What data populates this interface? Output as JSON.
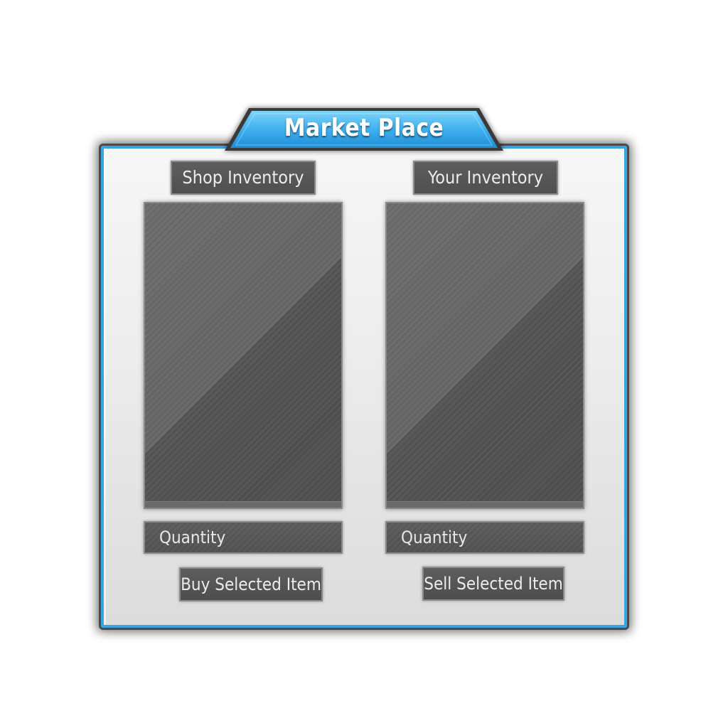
{
  "window": {
    "title": "Market Place"
  },
  "shop": {
    "header": "Shop Inventory",
    "quantity_placeholder": "Quantity",
    "action_label": "Buy Selected Item"
  },
  "player": {
    "header": "Your Inventory",
    "quantity_placeholder": "Quantity",
    "action_label": "Sell Selected Item"
  },
  "colors": {
    "accent": "#3aa3e6",
    "accent_light": "#66c6f7",
    "panel": "#5a5a5a",
    "frame_bg": "#eeeeee"
  }
}
